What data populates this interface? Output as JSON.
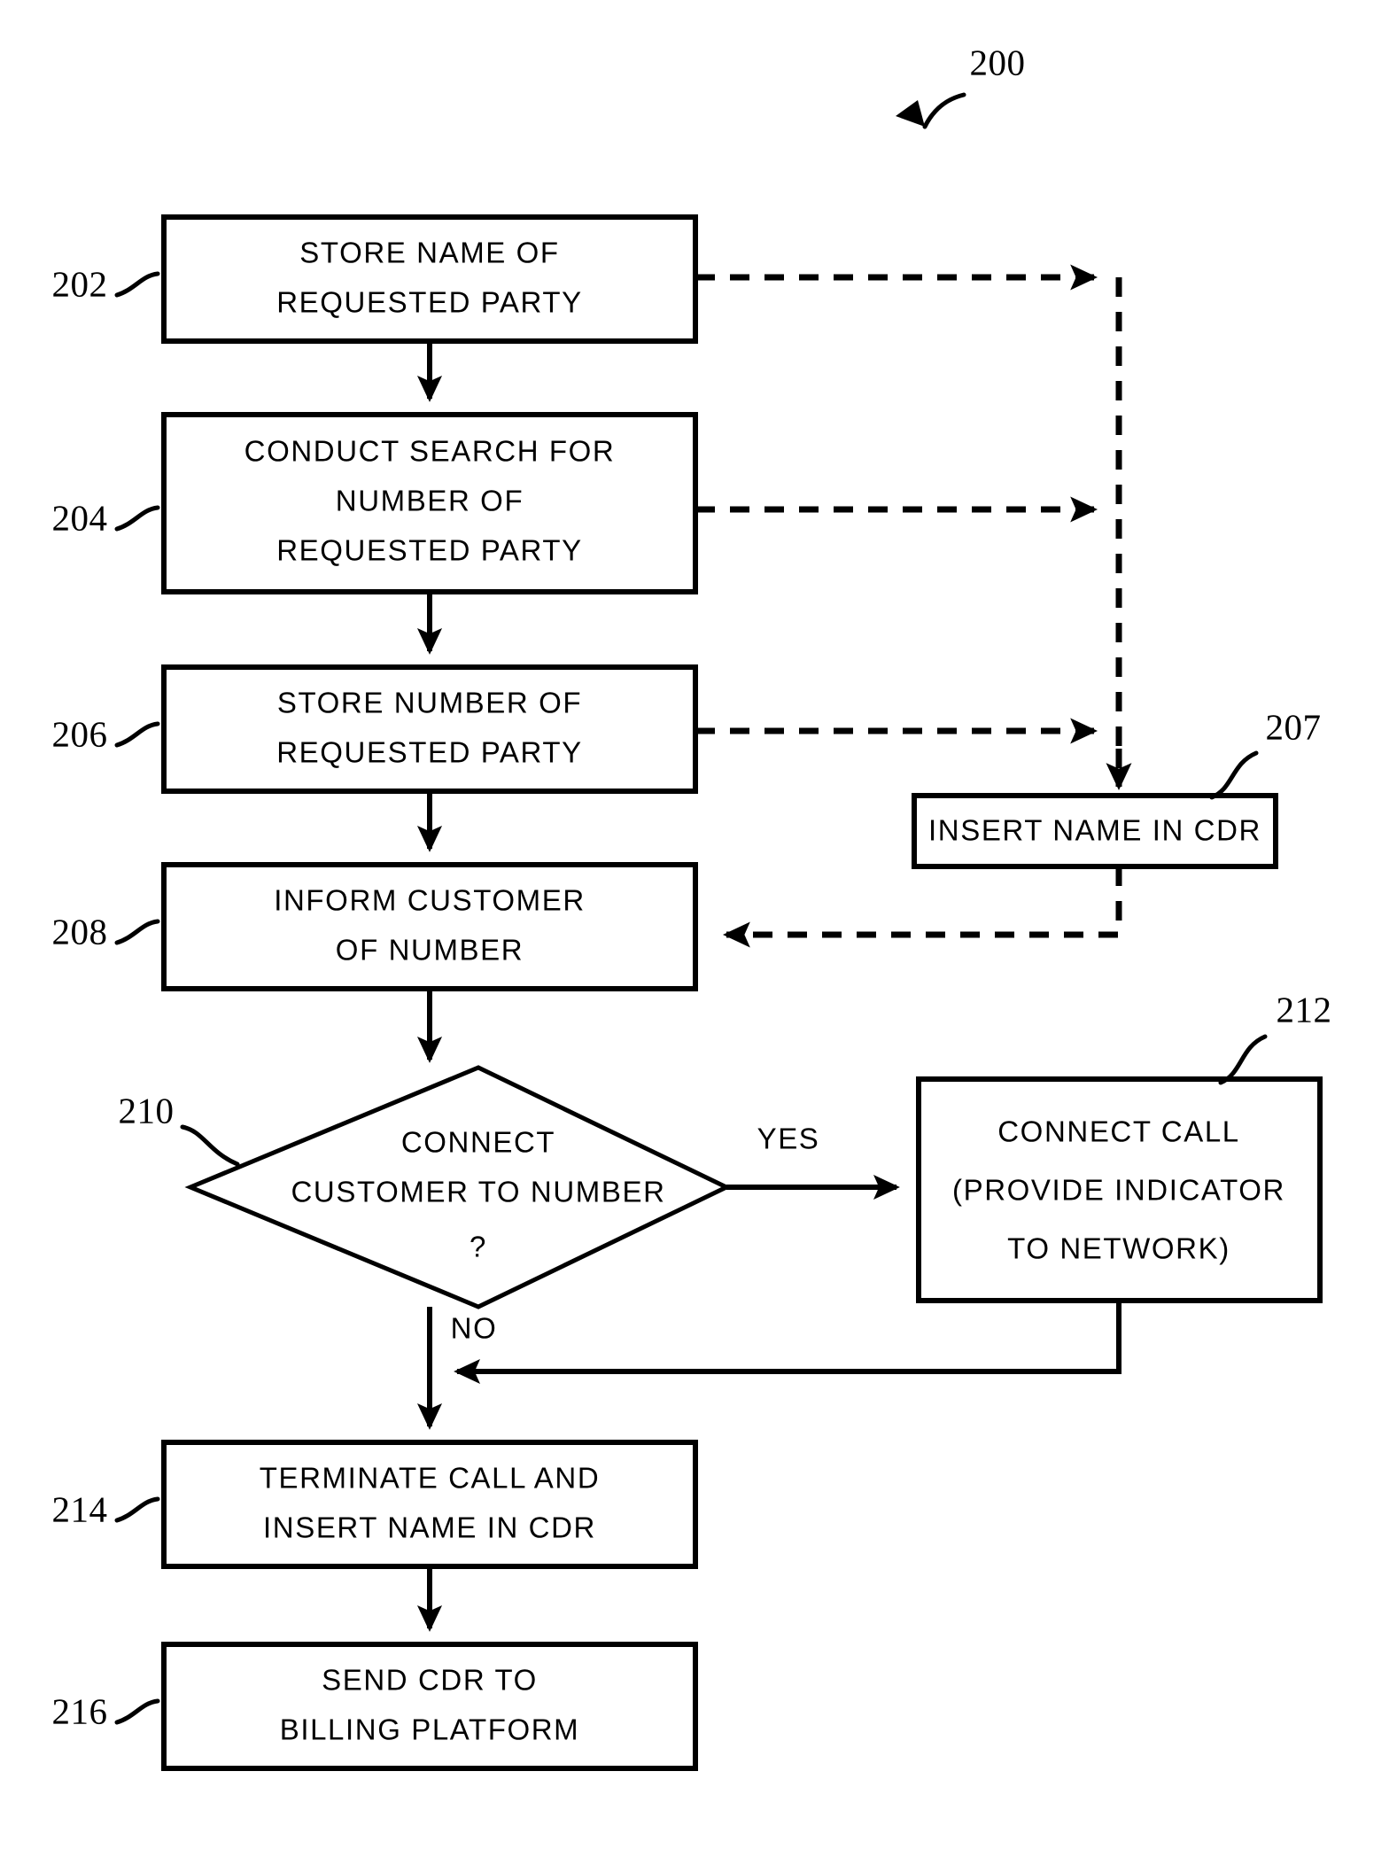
{
  "figure": {
    "label": "200",
    "type": "patent-flowchart"
  },
  "nodes": [
    {
      "ref": "202",
      "shape": "process",
      "lines": [
        "STORE NAME OF",
        "REQUESTED PARTY"
      ]
    },
    {
      "ref": "204",
      "shape": "process",
      "lines": [
        "CONDUCT SEARCH FOR",
        "NUMBER OF",
        "REQUESTED PARTY"
      ]
    },
    {
      "ref": "206",
      "shape": "process",
      "lines": [
        "STORE NUMBER OF",
        "REQUESTED PARTY"
      ]
    },
    {
      "ref": "207",
      "shape": "process",
      "lines": [
        "INSERT NAME IN CDR"
      ]
    },
    {
      "ref": "208",
      "shape": "process",
      "lines": [
        "INFORM CUSTOMER",
        "OF NUMBER"
      ]
    },
    {
      "ref": "210",
      "shape": "decision",
      "lines": [
        "CONNECT",
        "CUSTOMER TO NUMBER",
        "?"
      ]
    },
    {
      "ref": "212",
      "shape": "process",
      "lines": [
        "CONNECT CALL",
        "(PROVIDE INDICATOR",
        "TO NETWORK)"
      ]
    },
    {
      "ref": "214",
      "shape": "process",
      "lines": [
        "TERMINATE CALL AND",
        "INSERT NAME IN CDR"
      ]
    },
    {
      "ref": "216",
      "shape": "process",
      "lines": [
        "SEND CDR TO",
        "BILLING PLATFORM"
      ]
    }
  ],
  "branch_labels": {
    "yes": "YES",
    "no": "NO"
  },
  "colors": {
    "ink": "#000000",
    "paper": "#ffffff"
  }
}
